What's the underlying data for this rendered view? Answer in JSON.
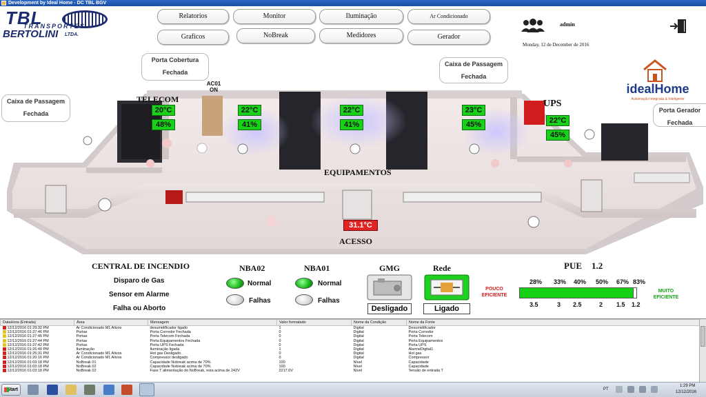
{
  "window": {
    "title": "Development by Ideal Home - DC TBL BGV"
  },
  "logo": {
    "line1": "TBL",
    "line2": "TRANSPORTES",
    "line3": "BERTOLINI",
    "line4": "LTDA."
  },
  "nav": {
    "relatorios": "Relatorios",
    "monitor": "Monitor",
    "iluminacao": "Iluminação",
    "ar_condicionado": "Ar Condicionado",
    "graficos": "Graficos",
    "nobreak": "NoBreak",
    "medidores": "Medidores",
    "gerador": "Gerador"
  },
  "user": {
    "name": "admin",
    "date": "Monday, 12 de December de 2016"
  },
  "brand": {
    "name": "idealHome",
    "tagline": "Automação Integrada & Inteligente"
  },
  "doors": {
    "porta_cobertura": {
      "title": "Porta Cobertura",
      "status": "Fechada"
    },
    "caixa_passagem_left": {
      "title": "Caixa de Passagem",
      "status": "Fechada"
    },
    "caixa_passagem_top": {
      "title": "Caixa de Passagem",
      "status": "Fechada"
    },
    "porta_gerador": {
      "title": "Porta Gerador",
      "status": "Fechada"
    }
  },
  "rooms": {
    "telecom": "TELECOM",
    "ups": "UPS",
    "equipamentos": "EQUIPAMENTOS",
    "acesso": "ACESSO"
  },
  "ac01": {
    "name": "AC01",
    "state": "ON"
  },
  "sensors": {
    "telecom": {
      "temp": "20°C",
      "hum": "48%"
    },
    "eq1": {
      "temp": "22°C",
      "hum": "41%"
    },
    "eq2": {
      "temp": "22°C",
      "hum": "41%"
    },
    "eq3": {
      "temp": "23°C",
      "hum": "45%"
    },
    "ups": {
      "temp": "22°C",
      "hum": "45%"
    },
    "acesso": {
      "temp": "31.1°C"
    }
  },
  "fire": {
    "title": "CENTRAL DE INCENDIO",
    "items": [
      "Disparo de Gas",
      "Sensor em Alarme",
      "Falha ou Aborto"
    ]
  },
  "nba02": {
    "title": "NBA02",
    "normal": "Normal",
    "falhas": "Falhas"
  },
  "nba01": {
    "title": "NBA01",
    "normal": "Normal",
    "falhas": "Falhas"
  },
  "gmg": {
    "title": "GMG",
    "status": "Desligado"
  },
  "rede": {
    "title": "Rede",
    "status": "Ligado"
  },
  "pue": {
    "label": "PUE",
    "value": "1.2",
    "left_label": "POUCO EFICIENTE",
    "right_label": "MUITO EFICIENTE",
    "percents": [
      "28%",
      "33%",
      "40%",
      "50%",
      "67%",
      "83%"
    ],
    "scale": [
      "3.5",
      "3",
      "2.5",
      "2",
      "1.5",
      "1.2"
    ]
  },
  "alarm_table": {
    "columns": [
      "DataHora (Entrada)",
      "Área",
      "Mensagem",
      "Valor formatado",
      "Nome da Condição",
      "Nome da Fonte"
    ],
    "rows": [
      {
        "icon": "red",
        "cells": [
          "12/12/2016 01:29:32 PM",
          "Ar Condicionado M1 Ativos",
          "desumidificador ligado",
          "1",
          "Digital",
          "Desumidificador"
        ]
      },
      {
        "icon": "yel",
        "cells": [
          "12/12/2016 01:27:46 PM",
          "Portas",
          "Porta Corredor Fechada",
          "0",
          "Digital",
          "Porta Corredor"
        ]
      },
      {
        "icon": "yel",
        "cells": [
          "12/12/2016 01:27:45 PM",
          "Portas",
          "Porta Telecom Fechada",
          "0",
          "Digital",
          "Porta Telecom"
        ]
      },
      {
        "icon": "yel",
        "cells": [
          "12/12/2016 01:27:44 PM",
          "Portas",
          "Porta Equipamentos Fechada",
          "0",
          "Digital",
          "Porta Equipamentos"
        ]
      },
      {
        "icon": "yel",
        "cells": [
          "12/12/2016 01:27:42 PM",
          "Portas",
          "Porta UPS Fechada",
          "0",
          "Digital",
          "Porta UPS"
        ]
      },
      {
        "icon": "red",
        "cells": [
          "12/12/2016 01:26:49 PM",
          "Iluminação",
          "Iluminação ligada",
          "1",
          "Digital",
          "AlarmeDigital1"
        ]
      },
      {
        "icon": "red",
        "cells": [
          "12/12/2016 01:25:31 PM",
          "Ar Condicionado M1 Ativos",
          "Hot gas Desligado",
          "0",
          "Digital",
          "Hot gas"
        ]
      },
      {
        "icon": "red",
        "cells": [
          "12/12/2016 01:20:16 PM",
          "Ar Condicionado M1 Ativos",
          "Compressor desligado",
          "0",
          "Digital",
          "Compressor"
        ]
      },
      {
        "icon": "red",
        "cells": [
          "12/12/2016 01:03:18 PM",
          "NoBreak 01",
          "Capacidade Nobreak acima de 70%",
          "100",
          "Nível",
          "Capacidade"
        ]
      },
      {
        "icon": "red",
        "cells": [
          "12/12/2016 01:03:18 PM",
          "NoBreak 02",
          "Capacidade Nobreak acima de 70%",
          "100",
          "Nível",
          "Capacidade"
        ]
      },
      {
        "icon": "red",
        "cells": [
          "12/12/2016 01:03:18 PM",
          "NoBreak 02",
          "Fase T alimentação do NoBreak, esta acima de 242V",
          "2217.0V",
          "Nível",
          "Tensão de entrada T"
        ]
      }
    ]
  },
  "taskbar": {
    "start": "Start",
    "lang": "PT",
    "time": "1:29 PM",
    "date": "12/12/2016"
  }
}
